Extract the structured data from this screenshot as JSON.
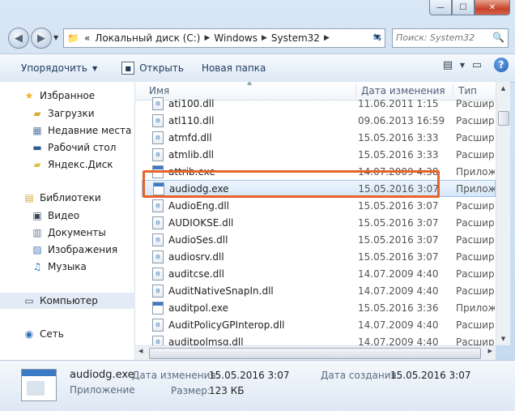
{
  "window": {
    "minimize": "—",
    "maximize": "☐",
    "close": "✕"
  },
  "address": {
    "overflow": "«",
    "segments": [
      "Локальный диск (C:)",
      "Windows",
      "System32"
    ],
    "search_placeholder": "Поиск: System32"
  },
  "toolbar": {
    "organize": "Упорядочить",
    "open": "Открыть",
    "new_folder": "Новая папка"
  },
  "nav": {
    "favorites": "Избранное",
    "downloads": "Загрузки",
    "recent": "Недавние места",
    "desktop": "Рабочий стол",
    "yandex": "Яндекс.Диск",
    "libraries": "Библиотеки",
    "video": "Видео",
    "documents": "Документы",
    "images": "Изображения",
    "music": "Музыка",
    "computer": "Компьютер",
    "network": "Сеть"
  },
  "columns": {
    "name": "Имя",
    "date": "Дата изменения",
    "type": "Тип"
  },
  "files": [
    {
      "name": "ati100.dll",
      "date": "11.06.2011 1:15",
      "type": "Расшир",
      "kind": "dll"
    },
    {
      "name": "atl110.dll",
      "date": "09.06.2013 16:59",
      "type": "Расшир",
      "kind": "dll"
    },
    {
      "name": "atmfd.dll",
      "date": "15.05.2016 3:33",
      "type": "Расшир",
      "kind": "dll"
    },
    {
      "name": "atmlib.dll",
      "date": "15.05.2016 3:33",
      "type": "Расшир",
      "kind": "dll"
    },
    {
      "name": "attrib.exe",
      "date": "14.07.2009 4:38",
      "type": "Прилож",
      "kind": "exe"
    },
    {
      "name": "audiodg.exe",
      "date": "15.05.2016 3:07",
      "type": "Прилож",
      "kind": "exe"
    },
    {
      "name": "AudioEng.dll",
      "date": "15.05.2016 3:07",
      "type": "Расшир",
      "kind": "dll"
    },
    {
      "name": "AUDIOKSE.dll",
      "date": "15.05.2016 3:07",
      "type": "Расшир",
      "kind": "dll"
    },
    {
      "name": "AudioSes.dll",
      "date": "15.05.2016 3:07",
      "type": "Расшир",
      "kind": "dll"
    },
    {
      "name": "audiosrv.dll",
      "date": "15.05.2016 3:07",
      "type": "Расшир",
      "kind": "dll"
    },
    {
      "name": "auditcse.dll",
      "date": "14.07.2009 4:40",
      "type": "Расшир",
      "kind": "dll"
    },
    {
      "name": "AuditNativeSnapIn.dll",
      "date": "14.07.2009 4:40",
      "type": "Расшир",
      "kind": "dll"
    },
    {
      "name": "auditpol.exe",
      "date": "15.05.2016 3:36",
      "type": "Прилож",
      "kind": "exe"
    },
    {
      "name": "AuditPolicyGPInterop.dll",
      "date": "14.07.2009 4:40",
      "type": "Расшир",
      "kind": "dll"
    },
    {
      "name": "auditpolmsg.dll",
      "date": "14.07.2009 4:40",
      "type": "Расшир",
      "kind": "dll"
    }
  ],
  "details": {
    "name": "audiodg.exe",
    "kind": "Приложение",
    "modified_label": "Дата изменения:",
    "modified_value": "15.05.2016 3:07",
    "size_label": "Размер:",
    "size_value": "123 КБ",
    "created_label": "Дата создания:",
    "created_value": "15.05.2016 3:07"
  },
  "selected_file_index": 5,
  "colors": {
    "highlight_border": "#e8632b",
    "selection": "#d6e7fa"
  }
}
